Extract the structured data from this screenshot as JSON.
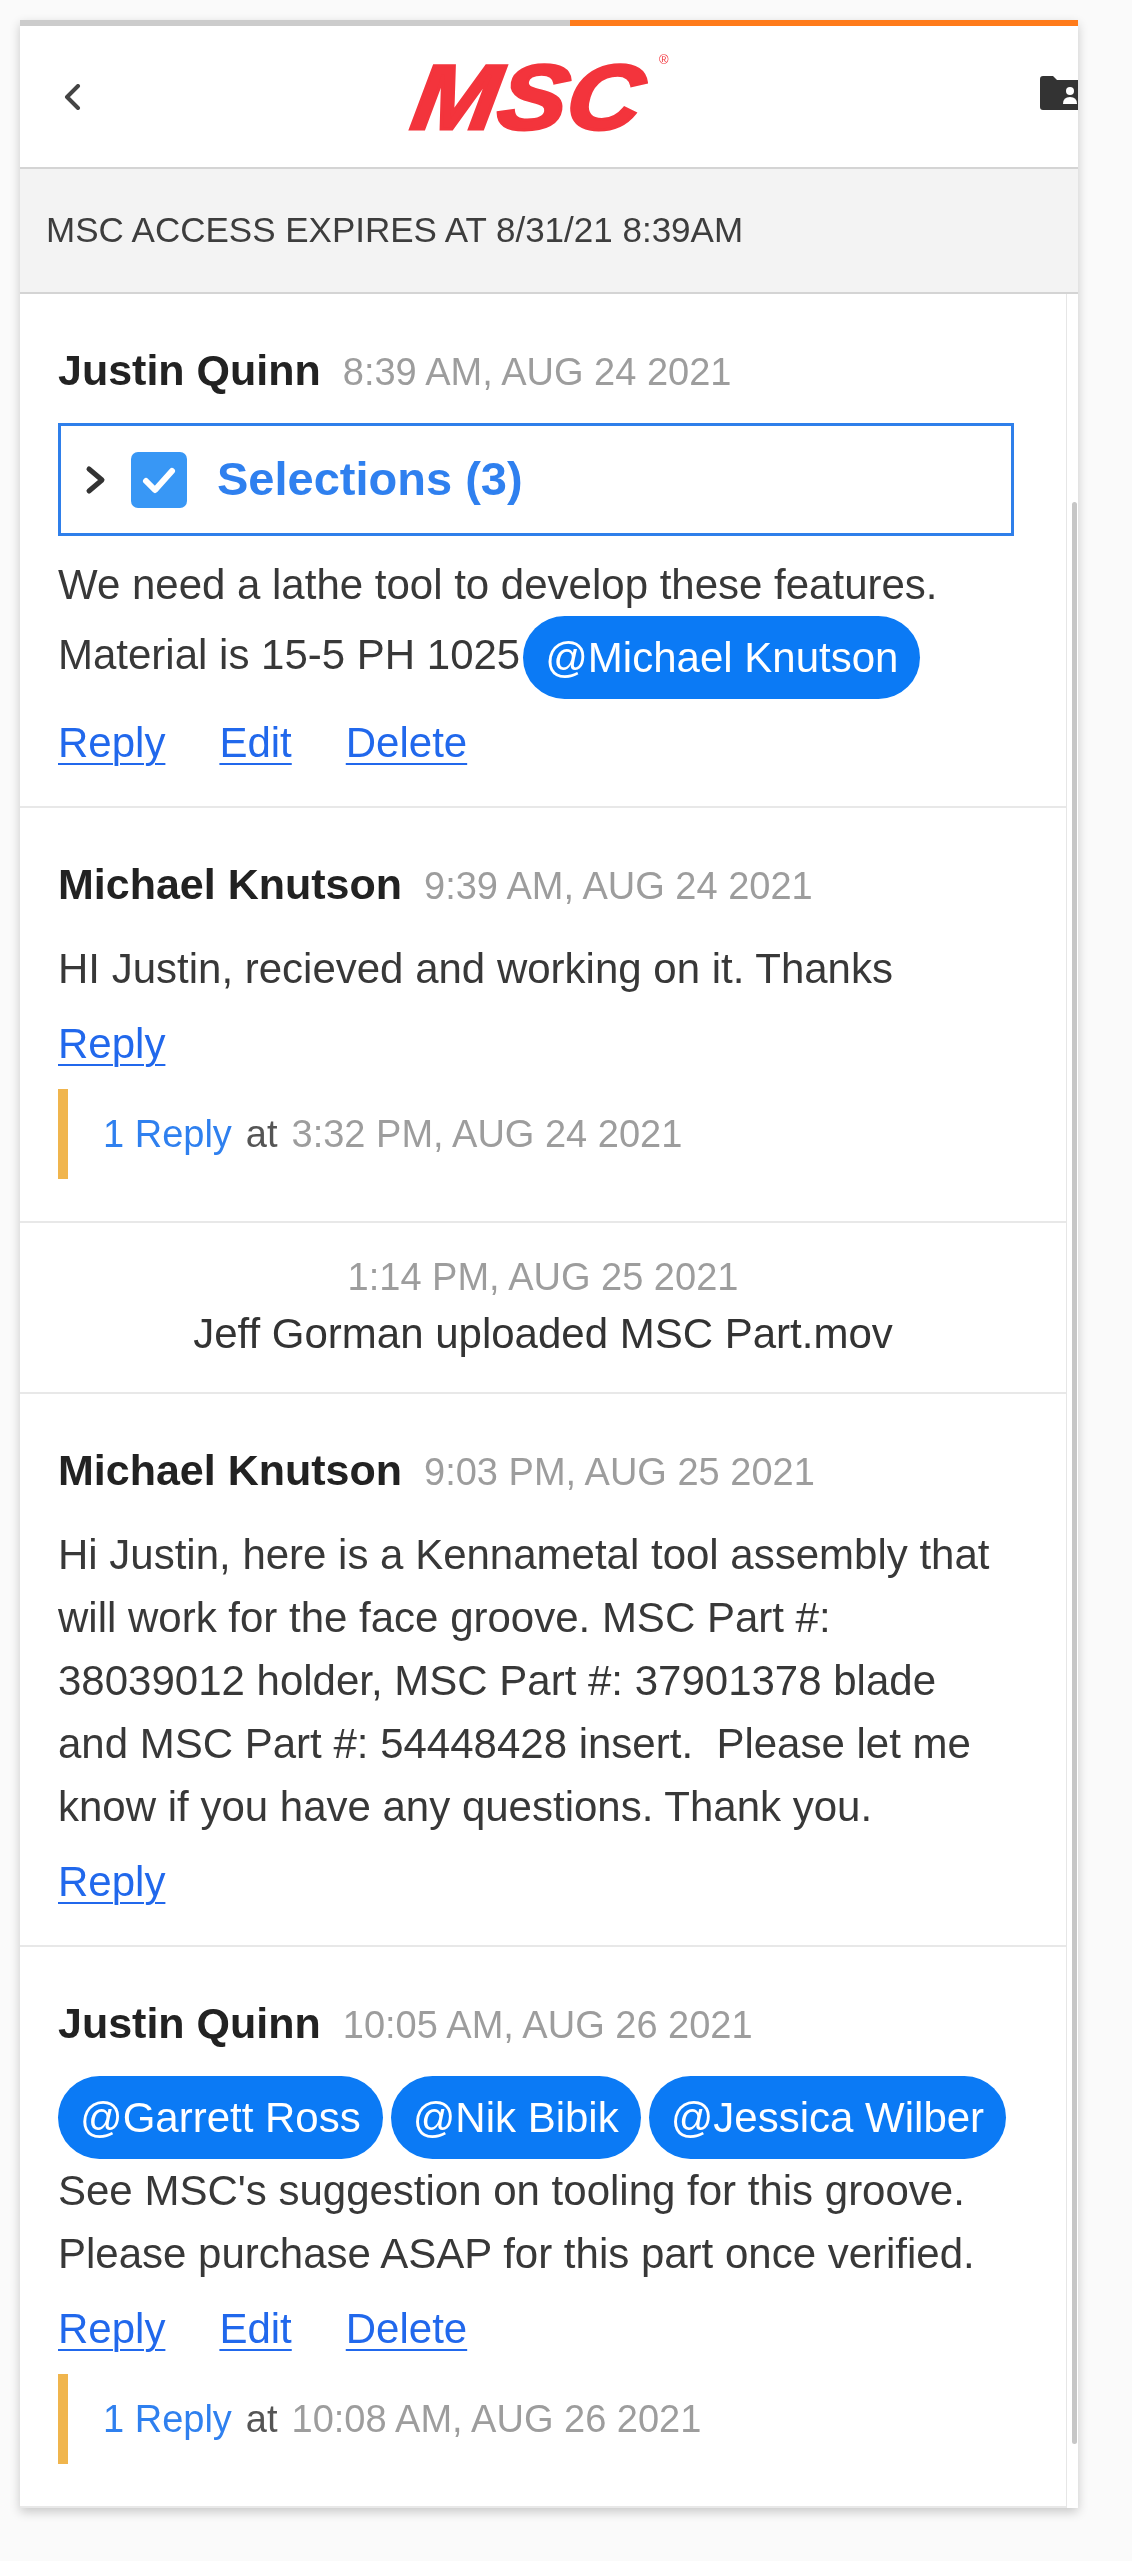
{
  "progress_bar": {
    "level": 0.48
  },
  "header": {
    "logo": {
      "text": "MSC",
      "mark": "®"
    }
  },
  "banner": {
    "text": "MSC ACCESS EXPIRES AT 8/31/21 8:39AM"
  },
  "feed": [
    {
      "kind": "comment",
      "author": "Justin Quinn",
      "time": "8:39 AM, AUG 24 2021",
      "selections": {
        "label": "Selections (3)",
        "expanded": false,
        "checked": true
      },
      "paragraphs": [
        [
          {
            "kind": "text",
            "text": "We need a lathe tool to develop these features."
          }
        ],
        [
          {
            "kind": "text",
            "text": "Material is 15-5 PH 1025"
          },
          {
            "kind": "mention",
            "text": "@Michael Knutson"
          }
        ]
      ],
      "actions": [
        "Reply",
        "Edit",
        "Delete"
      ]
    },
    {
      "kind": "comment",
      "author": "Michael Knutson",
      "time": "9:39 AM, AUG 24 2021",
      "paragraphs": [
        [
          {
            "kind": "text",
            "text": "HI Justin, recieved and working on it. Thanks"
          }
        ]
      ],
      "actions": [
        "Reply"
      ],
      "thread": {
        "label": "1 Reply",
        "connector": "at",
        "time": "3:32 PM, AUG 24 2021"
      }
    },
    {
      "kind": "event",
      "time": "1:14 PM, AUG 25 2021",
      "text": "Jeff Gorman uploaded MSC Part.mov"
    },
    {
      "kind": "comment",
      "author": "Michael Knutson",
      "time": "9:03 PM, AUG 25 2021",
      "paragraphs": [
        [
          {
            "kind": "text",
            "text": "Hi Justin, here is a Kennametal tool assembly that will work for the face groove. MSC Part #: 38039012 holder, MSC Part #: 37901378 blade and MSC Part #: 54448428 insert.  Please let me know if you have any questions. Thank you."
          }
        ]
      ],
      "actions": [
        "Reply"
      ]
    },
    {
      "kind": "comment",
      "author": "Justin Quinn",
      "time": "10:05 AM, AUG 26 2021",
      "paragraphs": [
        [
          {
            "kind": "mention",
            "text": "@Garrett Ross"
          },
          {
            "kind": "mention",
            "text": "@Nik Bibik"
          },
          {
            "kind": "mention",
            "text": "@Jessica Wilber"
          }
        ],
        [
          {
            "kind": "text",
            "text": "See MSC's suggestion on tooling for this groove. Please purchase ASAP for this part once verified."
          }
        ]
      ],
      "actions": [
        "Reply",
        "Edit",
        "Delete"
      ],
      "thread": {
        "label": "1 Reply",
        "connector": "at",
        "time": "10:08 AM, AUG 26 2021"
      }
    }
  ]
}
